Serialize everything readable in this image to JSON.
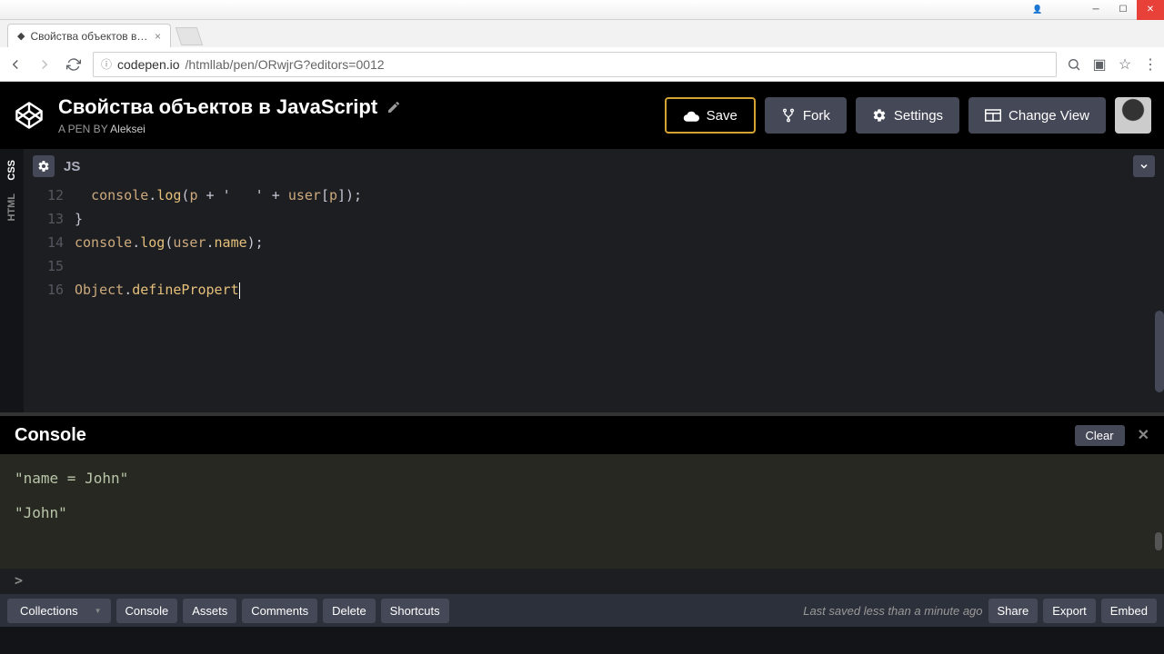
{
  "window": {
    "tab_title": "Свойства объектов в Ja",
    "url_host": "codepen.io",
    "url_path": "/htmllab/pen/ORwjrG?editors=0012"
  },
  "header": {
    "title": "Свойства объектов в JavaScript",
    "subtitle_prefix": "A PEN BY ",
    "author": "Aleksei",
    "buttons": {
      "save": "Save",
      "fork": "Fork",
      "settings": "Settings",
      "change_view": "Change View"
    }
  },
  "side_tabs": {
    "html": "HTML",
    "css": "CSS"
  },
  "editor": {
    "lang": "JS",
    "lines": [
      {
        "num": "12",
        "html": "  console.log(p + '   ' + user[p]);"
      },
      {
        "num": "13",
        "html": "}"
      },
      {
        "num": "14",
        "html": "console.log(user.name);"
      },
      {
        "num": "15",
        "html": ""
      },
      {
        "num": "16",
        "html": "Object.definePropert"
      }
    ]
  },
  "console": {
    "title": "Console",
    "clear": "Clear",
    "lines": [
      "\"name  = John\"",
      "\"John\""
    ],
    "prompt": ">"
  },
  "footer": {
    "collections": "Collections",
    "console": "Console",
    "assets": "Assets",
    "comments": "Comments",
    "delete": "Delete",
    "shortcuts": "Shortcuts",
    "status": "Last saved less than a minute ago",
    "share": "Share",
    "export": "Export",
    "embed": "Embed"
  }
}
